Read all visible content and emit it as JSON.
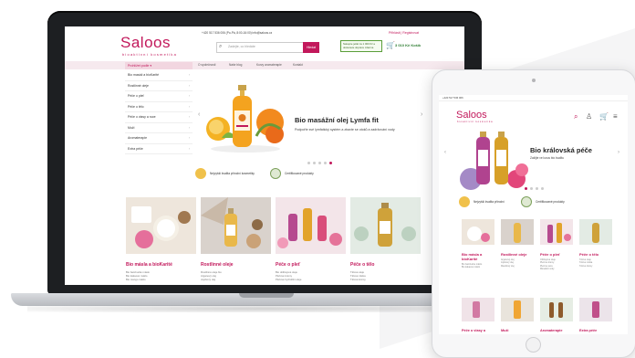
{
  "colors": {
    "brand": "#c2185b",
    "green": "#2e7d32",
    "nav_bg": "#f6e9ee"
  },
  "laptop": {
    "logo": "Saloos",
    "logo_sub": "bioaktivní kosmetika",
    "phone": "+420 517 536 006 (Po-Pá, 8:00-16:00) info@saloos.cz",
    "login": "Přihlásit  |  Registrovat",
    "search_placeholder": "Zadejte, co hledáte",
    "search_button": "Hledat",
    "shipping_text": "Nakupte ještě za 1 000 Kč a dostanete dopravu zdarma",
    "cart": "3 010 Kč Košík",
    "nav_title": "Prohlížet podle ▾",
    "nav_links": [
      "O společnosti",
      "Naše blog",
      "Kurzy aromaterapie",
      "Kontakt"
    ],
    "sidebar": [
      "Bio masáž a bioKarité",
      "Rostlinné oleje",
      "Péče o pleť",
      "Péče o tělo",
      "Péče o vlasy a ruce",
      "Muži",
      "Aromaterapie",
      "Extra péče"
    ],
    "hero_title": "Bio masážní olej Lymfa fit",
    "hero_subtitle": "Podpořte své lymfatický systém a zbavte se otoků a zadržování vody",
    "badge1": "Nejvyšší kvalita přírodní kosmetiky",
    "badge2": "Certifikované produkty",
    "products": [
      {
        "name": "Bio másla a bioKarité",
        "desc": [
          "Bio bambucké máslo",
          "Bio kakaové máslo",
          "Bio mango máslo"
        ]
      },
      {
        "name": "Rostlinné oleje",
        "desc": [
          "Rostlinné oleje bio",
          "Arganový olej",
          "Jojobový olej"
        ]
      },
      {
        "name": "Péče o pleť",
        "desc": [
          "Bio obličejové oleje",
          "Pleťové krémy",
          "Pleťové hydrofilní oleje"
        ]
      },
      {
        "name": "Péče o tělo",
        "desc": [
          "Tělové oleje",
          "Tělové mléka",
          "Tělové krémy"
        ]
      }
    ]
  },
  "tablet": {
    "phone": "+420 517 536 006",
    "logo": "Saloos",
    "logo_sub": "bioaktivní kosmetika",
    "hero_title": "Bio královská péče",
    "hero_subtitle": "Zažijte ve luxus bio kvalitu",
    "badge1": "Nejvyšší kvalita přírodní",
    "badge2": "Certifikované produkty",
    "products": [
      {
        "name": "Bio másla a bioKarité",
        "desc": [
          "Bio bambucké máslo",
          "Bio kakaové máslo"
        ]
      },
      {
        "name": "Rostlinné oleje",
        "desc": [
          "Arganový olej",
          "Jojobový olej",
          "Mandlový olej"
        ]
      },
      {
        "name": "Péče o pleť",
        "desc": [
          "Obličejové oleje",
          "Pleťové krémy",
          "Pleťové séra",
          "Micelární vody"
        ]
      },
      {
        "name": "Péče o tělo",
        "desc": [
          "Tělové oleje",
          "Tělové mléka",
          "Tělové krémy"
        ]
      }
    ],
    "products_row2": [
      "Péče o vlasy a",
      "Muži",
      "Aromaterapie",
      "Extra péče"
    ]
  }
}
